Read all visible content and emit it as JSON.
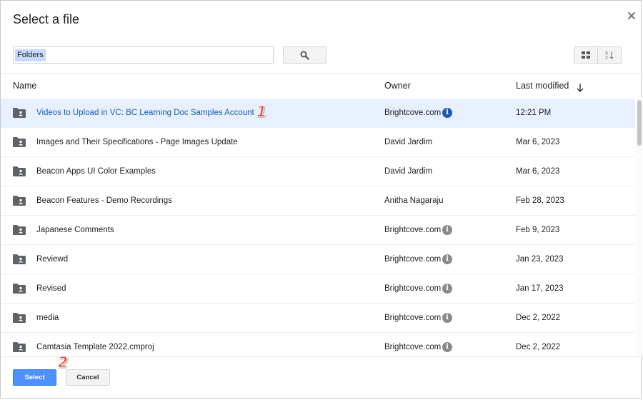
{
  "dialog": {
    "title": "Select a file",
    "close_icon": "close-icon"
  },
  "search": {
    "value": "Folders",
    "button_icon": "search-icon"
  },
  "view_controls": {
    "grid_icon": "grid-view-icon",
    "sort_icon": "sort-az-icon"
  },
  "columns": {
    "name": "Name",
    "owner": "Owner",
    "modified": "Last modified"
  },
  "files": [
    {
      "name": "Videos to Upload in VC: BC Learning Doc Samples Account",
      "owner": "Brightcove.com",
      "info": true,
      "modified": "12:21 PM",
      "selected": true
    },
    {
      "name": "Images and Their Specifications - Page Images Update",
      "owner": "David Jardim",
      "info": false,
      "modified": "Mar 6, 2023",
      "selected": false
    },
    {
      "name": "Beacon Apps UI Color Examples",
      "owner": "David Jardim",
      "info": false,
      "modified": "Mar 6, 2023",
      "selected": false
    },
    {
      "name": "Beacon Features - Demo Recordings",
      "owner": "Anitha Nagaraju",
      "info": false,
      "modified": "Feb 28, 2023",
      "selected": false
    },
    {
      "name": "Japanese Comments",
      "owner": "Brightcove.com",
      "info": true,
      "modified": "Feb 9, 2023",
      "selected": false
    },
    {
      "name": "Reviewd",
      "owner": "Brightcove.com",
      "info": true,
      "modified": "Jan 23, 2023",
      "selected": false
    },
    {
      "name": "Revised",
      "owner": "Brightcove.com",
      "info": true,
      "modified": "Jan 17, 2023",
      "selected": false
    },
    {
      "name": "media",
      "owner": "Brightcove.com",
      "info": true,
      "modified": "Dec 2, 2022",
      "selected": false
    },
    {
      "name": "Camtasia Template 2022.cmproj",
      "owner": "Brightcove.com",
      "info": true,
      "modified": "Dec 2, 2022",
      "selected": false
    }
  ],
  "footer": {
    "select_label": "Select",
    "cancel_label": "Cancel"
  },
  "callouts": [
    "1",
    "2"
  ],
  "colors": {
    "accent": "#4d90fe",
    "selected_row": "#e8f0fe",
    "selected_text": "#1a5db0",
    "callout": "#e2483d"
  }
}
